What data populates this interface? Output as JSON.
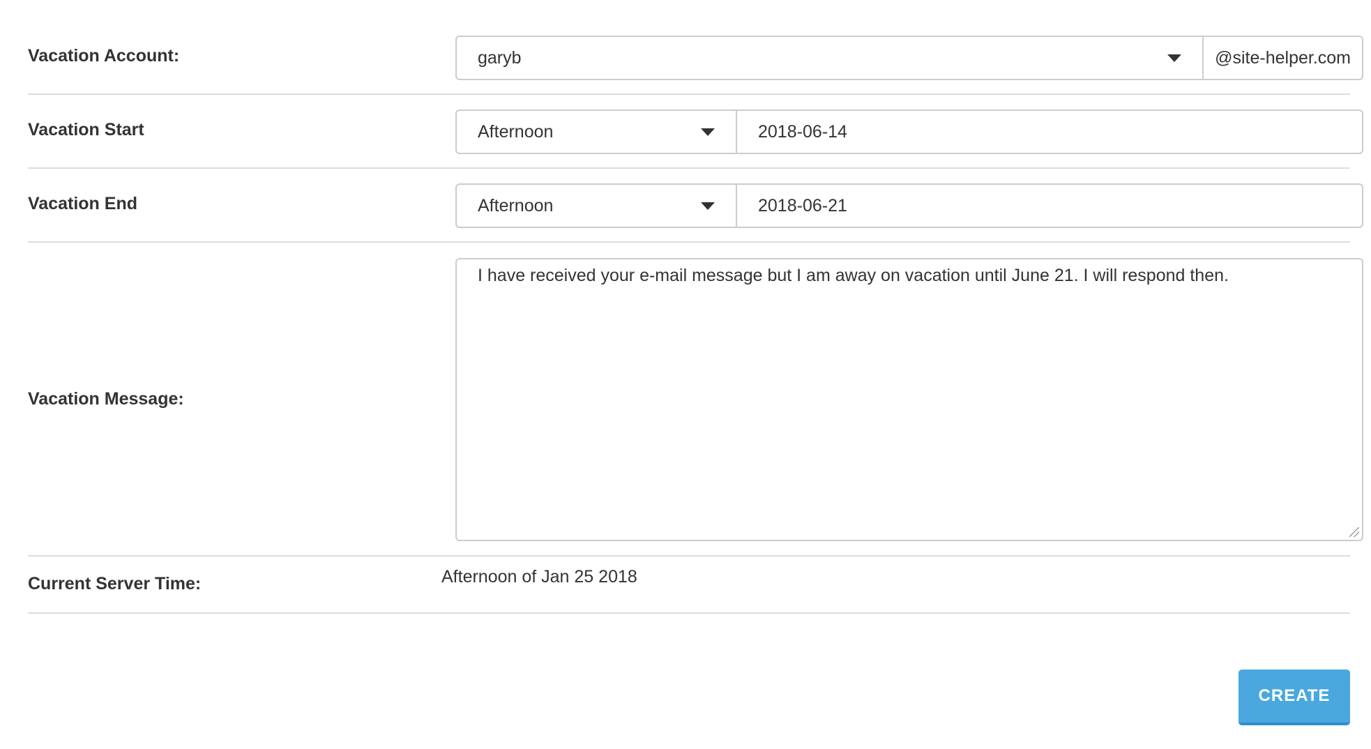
{
  "form": {
    "account": {
      "label": "Vacation Account:",
      "selected": "garyb",
      "domain": "@site-helper.com"
    },
    "start": {
      "label": "Vacation Start",
      "period": "Afternoon",
      "date": "2018-06-14"
    },
    "end": {
      "label": "Vacation End",
      "period": "Afternoon",
      "date": "2018-06-21"
    },
    "message": {
      "label": "Vacation Message:",
      "value": "I have received your e-mail message but I am away on vacation until June 21. I will respond then."
    },
    "server_time": {
      "label": "Current Server Time:",
      "value": "Afternoon of Jan 25 2018"
    },
    "create_label": "CREATE"
  },
  "colors": {
    "accent": "#4aa8de",
    "border": "#cccccc",
    "divider": "#dddddd",
    "text": "#333333"
  },
  "icons": {
    "dropdown": "chevron-down-icon",
    "resize": "resize-grip-icon"
  }
}
